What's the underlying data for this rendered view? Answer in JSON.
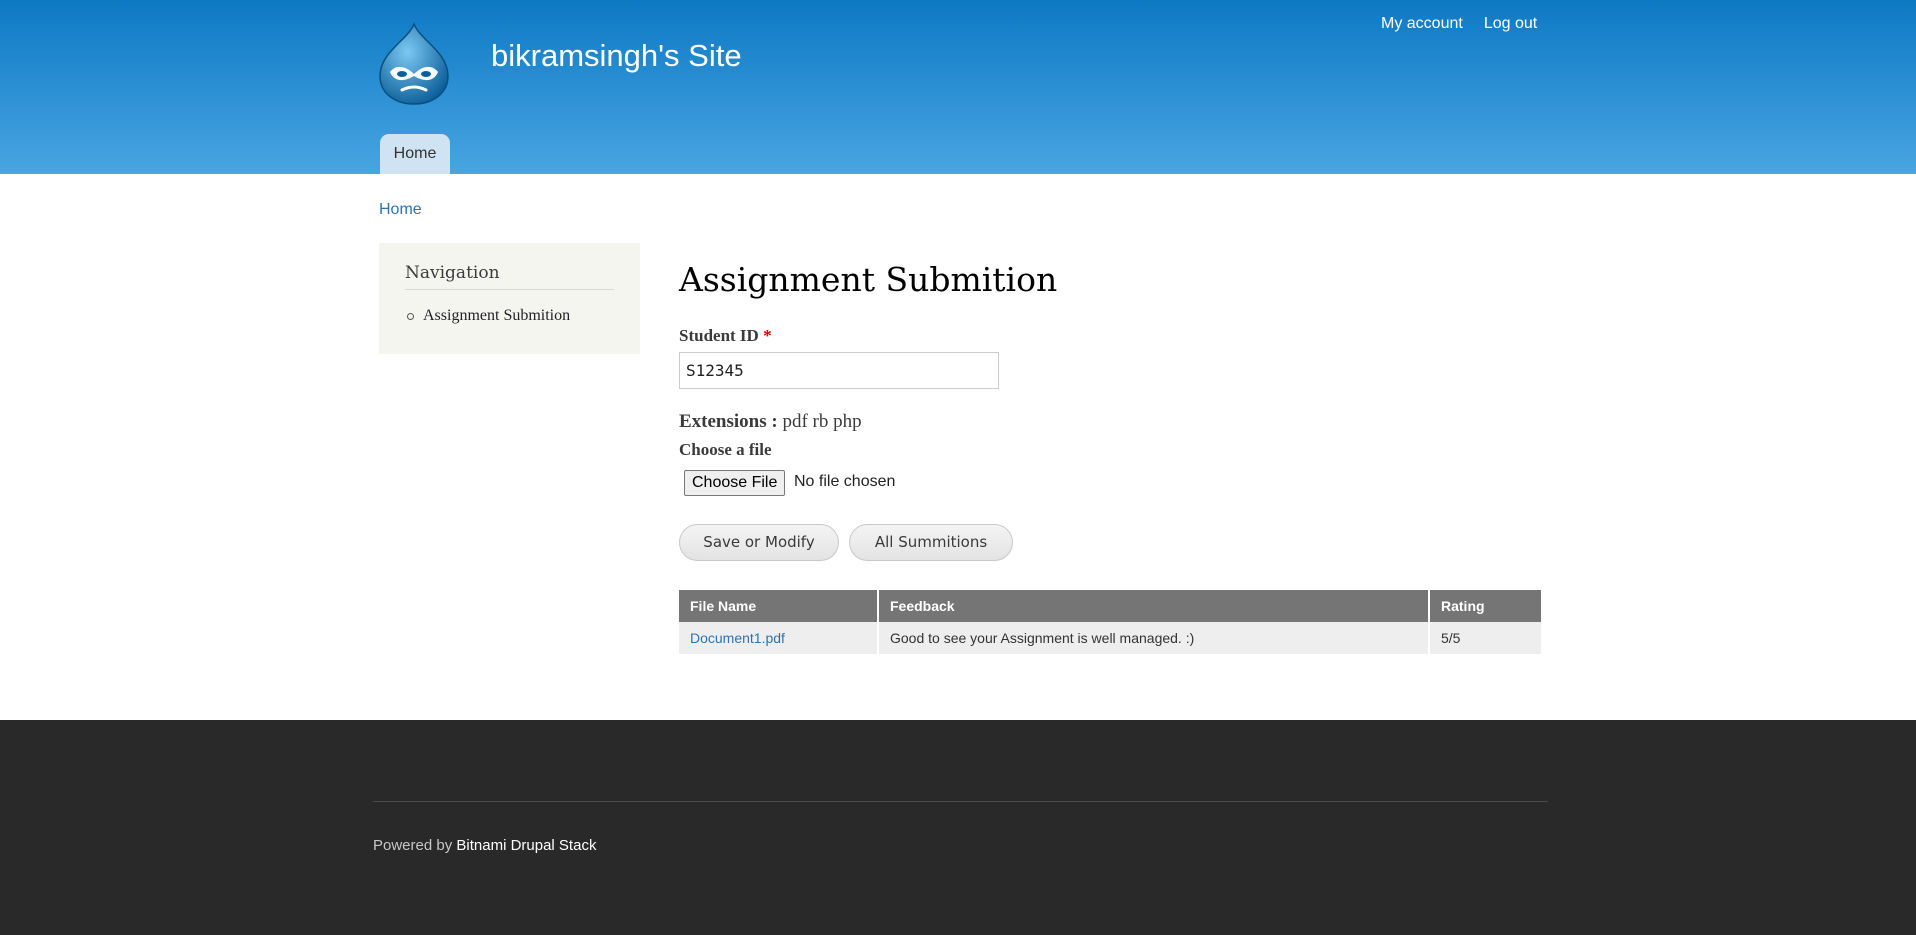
{
  "header": {
    "site_name": "bikramsingh's Site",
    "secondary_menu": [
      "My account",
      "Log out"
    ],
    "main_tab": "Home"
  },
  "breadcrumb": "Home",
  "sidebar": {
    "title": "Navigation",
    "items": [
      {
        "label": "Assignment Submition"
      }
    ]
  },
  "content": {
    "title": "Assignment Submition",
    "student_id_label": "Student ID",
    "required_mark": "*",
    "student_id_value": "S12345",
    "extensions_label": "Extensions :",
    "extensions_value": "pdf rb php",
    "choose_file_label": "Choose a file",
    "choose_file_button": "Choose File",
    "no_file_text": "No file chosen",
    "save_button": "Save or Modify",
    "all_button": "All Summitions"
  },
  "table": {
    "headers": [
      "File Name",
      "Feedback",
      "Rating"
    ],
    "rows": [
      {
        "file_name": "Document1.pdf",
        "feedback": "Good to see your Assignment is well managed. :)",
        "rating": "5/5"
      }
    ]
  },
  "footer": {
    "powered_by": "Powered by",
    "link": "Bitnami Drupal Stack"
  },
  "colors": {
    "header_top": "#0d79c4",
    "header_bottom": "#48a5e2",
    "link": "#2c73b1",
    "footer_bg": "#292929"
  }
}
